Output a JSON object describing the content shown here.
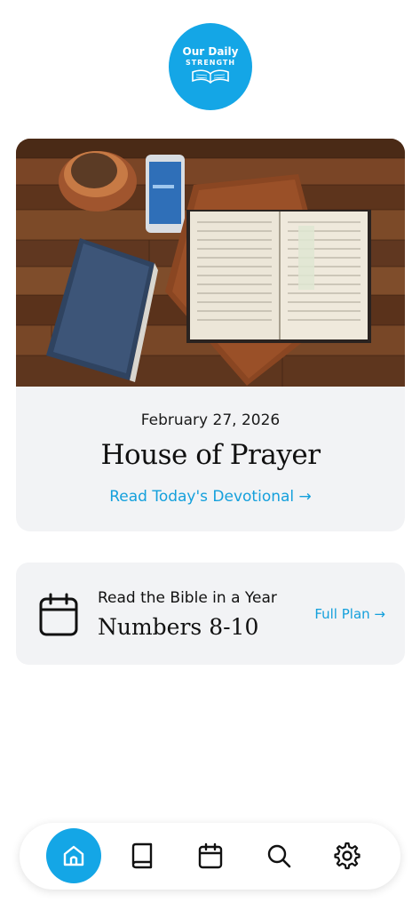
{
  "logo": {
    "line1": "Our Daily",
    "line2": "STRENGTH"
  },
  "devotional": {
    "date": "February 27, 2026",
    "title": "House of Prayer",
    "link_label": "Read Today's Devotional →"
  },
  "bible_plan": {
    "label": "Read the Bible in a Year",
    "reading": "Numbers 8-10",
    "link_label": "Full Plan →",
    "icon": "calendar-icon"
  },
  "nav": {
    "items": [
      {
        "icon": "home-icon",
        "active": true
      },
      {
        "icon": "book-icon",
        "active": false
      },
      {
        "icon": "calendar-icon",
        "active": false
      },
      {
        "icon": "search-icon",
        "active": false
      },
      {
        "icon": "gear-icon",
        "active": false
      }
    ]
  },
  "colors": {
    "accent": "#14a6e6",
    "link": "#14a0dc",
    "card": "#f2f3f5"
  }
}
